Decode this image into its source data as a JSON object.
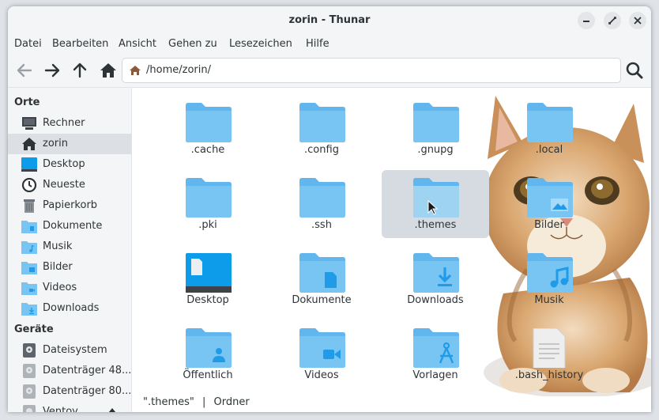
{
  "window": {
    "title": "zorin - Thunar"
  },
  "menu": [
    "Datei",
    "Bearbeiten",
    "Ansicht",
    "Gehen zu",
    "Lesezeichen",
    "Hilfe"
  ],
  "location": {
    "path": "/home/zorin/"
  },
  "sidebar": {
    "places_header": "Orte",
    "places": [
      {
        "label": "Rechner",
        "icon": "computer-icon"
      },
      {
        "label": "zorin",
        "icon": "home-icon",
        "selected": true
      },
      {
        "label": "Desktop",
        "icon": "desktop-icon"
      },
      {
        "label": "Neueste",
        "icon": "clock-icon"
      },
      {
        "label": "Papierkorb",
        "icon": "trash-icon"
      },
      {
        "label": "Dokumente",
        "icon": "documents-folder-icon"
      },
      {
        "label": "Musik",
        "icon": "music-folder-icon"
      },
      {
        "label": "Bilder",
        "icon": "pictures-folder-icon"
      },
      {
        "label": "Videos",
        "icon": "videos-folder-icon"
      },
      {
        "label": "Downloads",
        "icon": "downloads-folder-icon"
      }
    ],
    "devices_header": "Geräte",
    "devices": [
      {
        "label": "Dateisystem",
        "icon": "filesystem-icon"
      },
      {
        "label": "Datenträger 48...",
        "icon": "drive-icon"
      },
      {
        "label": "Datenträger 80...",
        "icon": "drive-icon"
      },
      {
        "label": "Ventoy",
        "icon": "drive-icon"
      }
    ]
  },
  "files": [
    {
      "label": ".cache",
      "type": "folder",
      "emblem": "none"
    },
    {
      "label": ".config",
      "type": "folder",
      "emblem": "none"
    },
    {
      "label": ".gnupg",
      "type": "folder",
      "emblem": "none"
    },
    {
      "label": ".local",
      "type": "folder",
      "emblem": "none"
    },
    {
      "label": ".pki",
      "type": "folder",
      "emblem": "none"
    },
    {
      "label": ".ssh",
      "type": "folder",
      "emblem": "none"
    },
    {
      "label": ".themes",
      "type": "folder",
      "emblem": "none",
      "selected": true
    },
    {
      "label": "Bilder",
      "type": "folder",
      "emblem": "picture"
    },
    {
      "label": "Desktop",
      "type": "desktop",
      "emblem": "none"
    },
    {
      "label": "Dokumente",
      "type": "folder",
      "emblem": "document"
    },
    {
      "label": "Downloads",
      "type": "folder",
      "emblem": "download"
    },
    {
      "label": "Musik",
      "type": "folder",
      "emblem": "music"
    },
    {
      "label": "Öffentlich",
      "type": "folder",
      "emblem": "person"
    },
    {
      "label": "Videos",
      "type": "folder",
      "emblem": "video"
    },
    {
      "label": "Vorlagen",
      "type": "folder",
      "emblem": "compass"
    },
    {
      "label": ".bash_history",
      "type": "text-file",
      "emblem": "none"
    }
  ],
  "status": {
    "name": "\".themes\"",
    "separator": "|",
    "kind": "Ordner"
  },
  "colors": {
    "folder": "#78c5f4",
    "folder_tab": "#62b6ee",
    "emblem": "#1f9be8",
    "selection": "#d6dbe1"
  }
}
